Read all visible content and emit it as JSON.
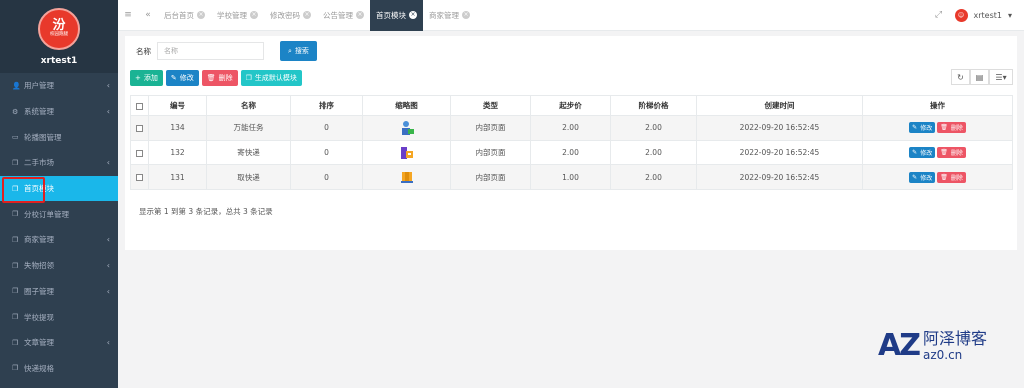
{
  "sidebar": {
    "logo_mark": "汾",
    "logo_text": "校园跑腿",
    "username": "xrtest1",
    "items": [
      {
        "label": "用户管理",
        "icon": "user-icon",
        "glyph": "👤",
        "arrow": "‹",
        "active": false
      },
      {
        "label": "系统管理",
        "icon": "gears-icon",
        "glyph": "⚙",
        "arrow": "‹",
        "active": false
      },
      {
        "label": "轮播图管理",
        "icon": "monitor-icon",
        "glyph": "▭",
        "arrow": "",
        "active": false
      },
      {
        "label": "二手市场",
        "icon": "copy-icon",
        "glyph": "❐",
        "arrow": "‹",
        "active": false
      },
      {
        "label": "首页模块",
        "icon": "copy-icon",
        "glyph": "❐",
        "arrow": "",
        "active": true
      },
      {
        "label": "分校订单管理",
        "icon": "copy-icon",
        "glyph": "❐",
        "arrow": "",
        "active": false
      },
      {
        "label": "商家管理",
        "icon": "copy-icon",
        "glyph": "❐",
        "arrow": "‹",
        "active": false
      },
      {
        "label": "失物招领",
        "icon": "copy-icon",
        "glyph": "❐",
        "arrow": "‹",
        "active": false
      },
      {
        "label": "圈子管理",
        "icon": "copy-icon",
        "glyph": "❐",
        "arrow": "‹",
        "active": false
      },
      {
        "label": "学校提现",
        "icon": "copy-icon",
        "glyph": "❐",
        "arrow": "",
        "active": false
      },
      {
        "label": "文章管理",
        "icon": "copy-icon",
        "glyph": "❐",
        "arrow": "‹",
        "active": false
      },
      {
        "label": "快递规格",
        "icon": "copy-icon",
        "glyph": "❐",
        "arrow": "",
        "active": false
      }
    ]
  },
  "topbar": {
    "tabs": [
      {
        "label": "后台首页",
        "active": false
      },
      {
        "label": "学校管理",
        "active": false
      },
      {
        "label": "修改密码",
        "active": false
      },
      {
        "label": "公告管理",
        "active": false
      },
      {
        "label": "首页模块",
        "active": true
      },
      {
        "label": "商家管理",
        "active": false
      }
    ],
    "user": "xrtest1",
    "user_caret": "▾"
  },
  "search": {
    "label": "名称",
    "placeholder": "名称",
    "button": "搜索"
  },
  "toolbar": {
    "add": "添加",
    "edit": "修改",
    "delete": "删除",
    "generate": "生成默认模块"
  },
  "table": {
    "headers": [
      "编号",
      "名称",
      "排序",
      "缩略图",
      "类型",
      "起步价",
      "阶梯价格",
      "创建时间",
      "操作"
    ],
    "rows": [
      {
        "id": "134",
        "name": "万能任务",
        "sort": "0",
        "thumb": "worker-icon",
        "type": "内部页面",
        "start_price": "2.00",
        "step_price": "2.00",
        "created": "2022-09-20 16:52:45"
      },
      {
        "id": "132",
        "name": "寄快递",
        "sort": "0",
        "thumb": "parcel-send-icon",
        "type": "内部页面",
        "start_price": "2.00",
        "step_price": "2.00",
        "created": "2022-09-20 16:52:45"
      },
      {
        "id": "131",
        "name": "取快递",
        "sort": "0",
        "thumb": "parcel-pickup-icon",
        "type": "内部页面",
        "start_price": "1.00",
        "step_price": "2.00",
        "created": "2022-09-20 16:52:45"
      }
    ],
    "row_edit": "修改",
    "row_delete": "删除"
  },
  "pagination": {
    "summary": "显示第 1 到第 3 条记录，总共 3 条记录"
  },
  "watermark": {
    "logo": "AZ",
    "name": "阿泽博客",
    "url": "az0.cn"
  },
  "colors": {
    "sidebar_bg": "#2f4050",
    "active_item": "#1ab7ea",
    "primary": "#1c84c6",
    "success": "#1ab394",
    "danger": "#ed5565",
    "info": "#23c6c8"
  }
}
